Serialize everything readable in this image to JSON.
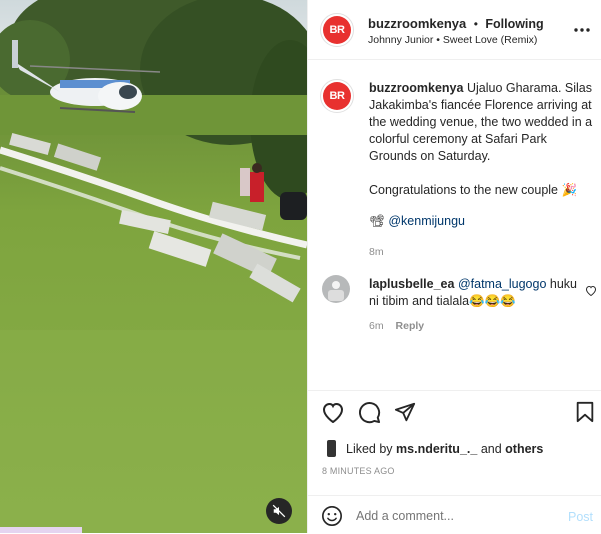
{
  "header": {
    "username": "buzzroomkenya",
    "dot": "•",
    "follow_label": "Following",
    "audio": "Johnny Junior • Sweet Love (Remix)",
    "avatar_text": "BR"
  },
  "caption": {
    "username": "buzzroomkenya",
    "text": "Ujaluo Gharama. Silas Jakakimba's fiancée Florence arriving at the wedding venue, the two wedded in a colorful ceremony at Safari Park Grounds on Saturday.",
    "congrats": "Congratulations to the new couple 🎉",
    "credit_emoji": "📽",
    "credit_handle": "@kenmijungu",
    "time": "8m"
  },
  "comment": {
    "username": "laplusbelle_ea",
    "mention": "@fatma_lugogo",
    "text": "huku ni tibim and tialala😂😂😂",
    "time": "6m",
    "reply_label": "Reply"
  },
  "likes": {
    "prefix": "Liked by",
    "user": "ms.nderitu_._",
    "and": "and",
    "others": "others"
  },
  "timestamp": "8 MINUTES AGO",
  "add_comment": {
    "placeholder": "Add a comment...",
    "post_label": "Post"
  },
  "icons": {
    "more": "more-options-icon",
    "heart": "heart-icon",
    "comment": "comment-icon",
    "share": "share-icon",
    "save": "bookmark-icon",
    "smile": "emoji-icon",
    "mute": "muted-speaker-icon"
  },
  "colors": {
    "brand_red": "#e8312f",
    "link": "#00376b",
    "post_button": "#b2dffc",
    "grey_text": "#8e8e8e"
  }
}
